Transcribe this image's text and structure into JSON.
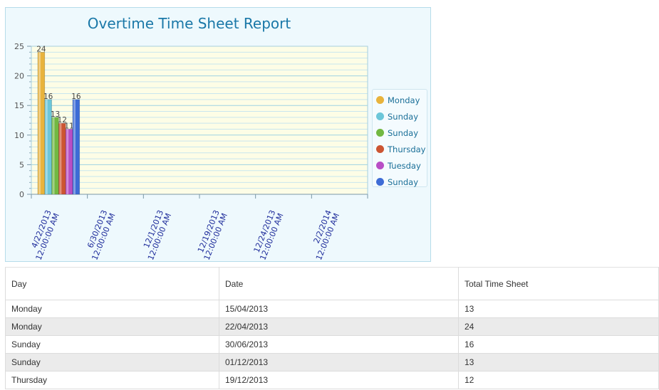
{
  "chart": {
    "title": "Overtime Time Sheet Report",
    "legend": [
      {
        "label": "Monday",
        "color": "#e8b33c"
      },
      {
        "label": "Sunday",
        "color": "#6cc6d9"
      },
      {
        "label": "Sunday",
        "color": "#72b842"
      },
      {
        "label": "Thursday",
        "color": "#cc5533"
      },
      {
        "label": "Tuesday",
        "color": "#b84ec6"
      },
      {
        "label": "Sunday",
        "color": "#3d6cd6"
      }
    ]
  },
  "chart_data": {
    "type": "bar",
    "title": "Overtime Time Sheet Report",
    "categories": [
      [
        "4/22/2013",
        "12:00:00 AM"
      ],
      [
        "6/30/2013",
        "12:00:00 AM"
      ],
      [
        "12/1/2013",
        "12:00:00 AM"
      ],
      [
        "12/19/2013",
        "12:00:00 AM"
      ],
      [
        "12/24/2013",
        "12:00:00 AM"
      ],
      [
        "2/2/2014",
        "12:00:00 AM"
      ]
    ],
    "series": [
      {
        "name": "Monday",
        "values": [
          24,
          null,
          null,
          null,
          null,
          null
        ],
        "color": "#e8b33c"
      },
      {
        "name": "Sunday",
        "values": [
          16,
          null,
          null,
          null,
          null,
          null
        ],
        "color": "#6cc6d9"
      },
      {
        "name": "Sunday",
        "values": [
          13,
          null,
          null,
          null,
          null,
          null
        ],
        "color": "#72b842"
      },
      {
        "name": "Thursday",
        "values": [
          12,
          null,
          null,
          null,
          null,
          null
        ],
        "color": "#cc5533"
      },
      {
        "name": "Tuesday",
        "values": [
          11,
          null,
          null,
          null,
          null,
          null
        ],
        "color": "#b84ec6"
      },
      {
        "name": "Sunday",
        "values": [
          16,
          null,
          null,
          null,
          null,
          null
        ],
        "color": "#3d6cd6"
      }
    ],
    "ylim": [
      0,
      25
    ],
    "yticks": [
      0,
      5,
      10,
      15,
      20,
      25
    ],
    "grid": true,
    "legend_position": "right"
  },
  "table": {
    "headers": [
      "Day",
      "Date",
      "Total Time Sheet"
    ],
    "rows": [
      [
        "Monday",
        "15/04/2013",
        "13"
      ],
      [
        "Monday",
        "22/04/2013",
        "24"
      ],
      [
        "Sunday",
        "30/06/2013",
        "16"
      ],
      [
        "Sunday",
        "01/12/2013",
        "13"
      ],
      [
        "Thursday",
        "19/12/2013",
        "12"
      ]
    ]
  }
}
